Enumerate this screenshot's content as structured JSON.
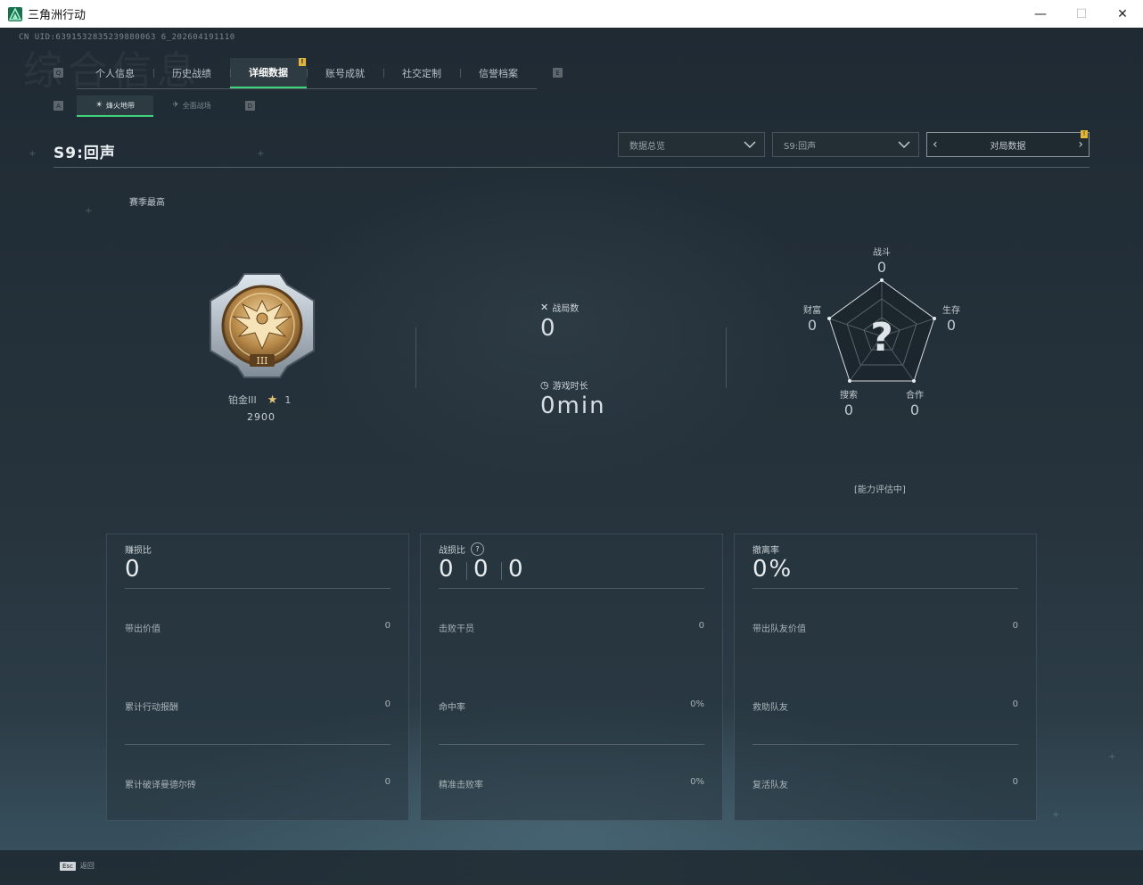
{
  "window": {
    "title": "三角洲行动",
    "controls": [
      "—",
      "☐",
      "✕"
    ]
  },
  "header": {
    "cnuid": "CN UID:6391532835239880063 6_202604191110",
    "watermark": "综合信息",
    "key_left": "Q",
    "key_right": "E",
    "tabs": [
      {
        "label": "个人信息"
      },
      {
        "label": "历史战绩"
      },
      {
        "label": "详细数据",
        "badge": "!"
      },
      {
        "label": "账号成就"
      },
      {
        "label": "社交定制"
      },
      {
        "label": "信誉档案"
      }
    ]
  },
  "subnav": {
    "key_left": "A",
    "key_right": "D",
    "tabs": [
      {
        "label": "烽火地带",
        "icon": "flame-zone-icon"
      },
      {
        "label": "全面战场",
        "icon": "battlefield-icon"
      }
    ]
  },
  "season": {
    "title": "S9:回声",
    "best_label": "赛季最高",
    "dropdown_overview": "数据总览",
    "dropdown_season": "S9:回声",
    "pager_label": "对局数据",
    "pager_badge": "!"
  },
  "rank": {
    "name": "铂金III",
    "stars": "1",
    "score": "2900",
    "emblem_numeral": "III"
  },
  "overview": {
    "matches_label": "战局数",
    "matches_value": "0",
    "playtime_label": "游戏时长",
    "playtime_value": "0min"
  },
  "radar": {
    "center": "?",
    "assessment": "[能力评估中]",
    "axes": [
      {
        "label": "战斗",
        "value": "0"
      },
      {
        "label": "生存",
        "value": "0"
      },
      {
        "label": "合作",
        "value": "0"
      },
      {
        "label": "搜索",
        "value": "0"
      },
      {
        "label": "财富",
        "value": "0"
      }
    ]
  },
  "cards": [
    {
      "label": "赚损比",
      "big": "0",
      "rows": [
        {
          "label": "带出价值",
          "value": "0"
        },
        {
          "label": "累计行动报酬",
          "value": "0"
        },
        {
          "label": "累计破译曼德尔砖",
          "value": "0"
        }
      ]
    },
    {
      "label": "战损比",
      "help": "?",
      "big_parts": [
        "0",
        "0",
        "0"
      ],
      "rows": [
        {
          "label": "击败干员",
          "value": "0"
        },
        {
          "label": "命中率",
          "value": "0%"
        },
        {
          "label": "精准击败率",
          "value": "0%"
        }
      ]
    },
    {
      "label": "撤离率",
      "big": "0%",
      "rows": [
        {
          "label": "带出队友价值",
          "value": "0"
        },
        {
          "label": "救助队友",
          "value": "0"
        },
        {
          "label": "复活队友",
          "value": "0"
        }
      ]
    }
  ],
  "footer": {
    "esc_key": "Esc",
    "esc_label": "返回"
  }
}
